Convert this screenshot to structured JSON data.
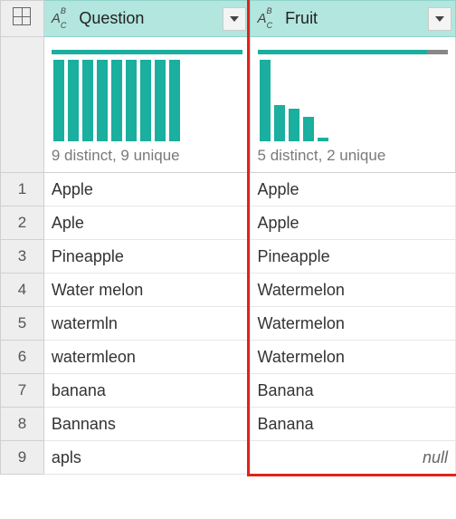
{
  "columns": [
    {
      "name": "Question",
      "type_icon": "ABC",
      "stats": "9 distinct, 9 unique",
      "quality_good_pct": 100,
      "bars": [
        100,
        100,
        100,
        100,
        100,
        100,
        100,
        100,
        100
      ]
    },
    {
      "name": "Fruit",
      "type_icon": "ABC",
      "stats": "5 distinct, 2 unique",
      "quality_good_pct": 89,
      "bars": [
        100,
        45,
        40,
        30,
        5
      ]
    }
  ],
  "rows": [
    {
      "idx": "1",
      "Question": "Apple",
      "Fruit": "Apple"
    },
    {
      "idx": "2",
      "Question": "Aple",
      "Fruit": "Apple"
    },
    {
      "idx": "3",
      "Question": "Pineapple",
      "Fruit": "Pineapple"
    },
    {
      "idx": "4",
      "Question": "Water melon",
      "Fruit": "Watermelon"
    },
    {
      "idx": "5",
      "Question": "watermln",
      "Fruit": "Watermelon"
    },
    {
      "idx": "6",
      "Question": "watermleon",
      "Fruit": "Watermelon"
    },
    {
      "idx": "7",
      "Question": "banana",
      "Fruit": "Banana"
    },
    {
      "idx": "8",
      "Question": "Bannans",
      "Fruit": "Banana"
    },
    {
      "idx": "9",
      "Question": "apls",
      "Fruit": null
    }
  ],
  "null_label": "null",
  "chart_data": [
    {
      "type": "bar",
      "title": "Question column value distribution",
      "categories": [
        "Apple",
        "Aple",
        "Pineapple",
        "Water melon",
        "watermln",
        "watermleon",
        "banana",
        "Bannans",
        "apls"
      ],
      "values": [
        1,
        1,
        1,
        1,
        1,
        1,
        1,
        1,
        1
      ],
      "stats": "9 distinct, 9 unique"
    },
    {
      "type": "bar",
      "title": "Fruit column value distribution",
      "categories": [
        "Watermelon",
        "Apple",
        "Banana",
        "Pineapple",
        "(null)"
      ],
      "values": [
        3,
        2,
        2,
        1,
        1
      ],
      "stats": "5 distinct, 2 unique"
    }
  ]
}
